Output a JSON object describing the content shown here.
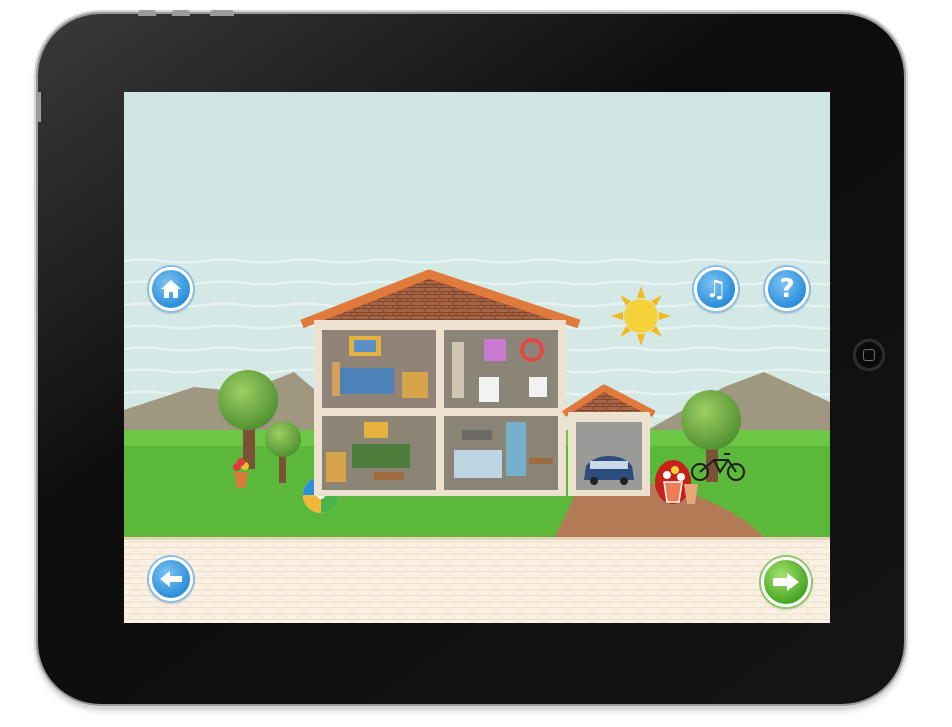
{
  "toolbar": {
    "help_glyph": "?",
    "music_glyph": "♫"
  },
  "icons": {
    "home": "home-icon",
    "music": "music-note-icon",
    "help": "question-mark-icon",
    "back": "arrow-left-icon",
    "next": "arrow-right-icon"
  },
  "colors": {
    "sky": "#cfe6e2",
    "grass": "#5cb83a",
    "roof": "#e07a3c",
    "brick": "#a86442",
    "button_blue": "#2b8fdb",
    "button_green": "#4aa624",
    "path_floor": "#faeee0"
  }
}
